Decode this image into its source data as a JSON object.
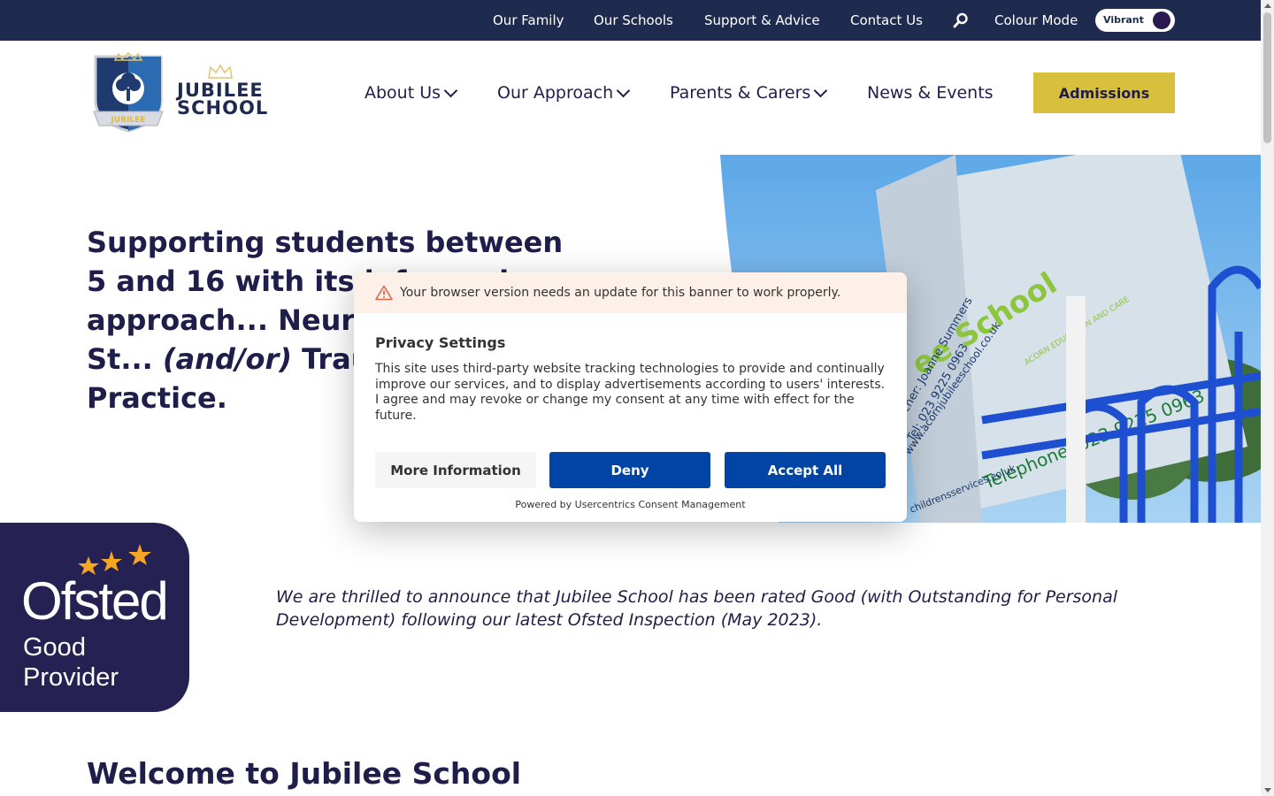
{
  "topbar": {
    "links": [
      "Our Family",
      "Our Schools",
      "Support & Advice",
      "Contact Us"
    ],
    "colour_mode_label": "Colour Mode",
    "toggle_label": "Vibrant"
  },
  "logo": {
    "line1": "JUBILEE",
    "line2": "SCHOOL",
    "badge_text": "JUBILEE"
  },
  "nav": {
    "items": [
      {
        "label": "About Us"
      },
      {
        "label": "Our Approach"
      },
      {
        "label": "Parents & Carers"
      },
      {
        "label": "News & Events"
      }
    ],
    "admissions_label": "Admissions"
  },
  "hero": {
    "title_part1": "Supporting students between 5 and 16 with its ",
    "title_part2": "informed approach... Neurodiversity St... ",
    "title_italic": "(and/or)",
    "title_part3": " Trauma ... Practice.",
    "photo_sign_school": "ee School",
    "photo_sign_head": "teacher: Joanne Summers",
    "photo_sign_tel_small": "Tel: 023 9225 0963",
    "photo_sign_web": "www.acornjubileeschool.co.uk",
    "photo_sign_telephone": "Telephone: 023 9225 0963",
    "photo_sign_acorn": "ACORN EDUCATION AND CARE",
    "photo_sign_email": "childrensservices.co.uk"
  },
  "ofsted": {
    "name": "Ofsted",
    "grade_line1": "Good",
    "grade_line2": "Provider"
  },
  "announcement": "We are thrilled to announce that Jubilee School has been rated Good (with Outstanding for Personal Development) following our latest Ofsted Inspection (May 2023).",
  "welcome_heading": "Welcome to Jubilee School",
  "consent": {
    "warning": "Your browser version needs an update for this banner to work properly.",
    "title": "Privacy Settings",
    "body": "This site uses third-party website tracking technologies to provide and continually improve our services, and to display advertisements according to users' interests. I agree and may revoke or change my consent at any time with effect for the future.",
    "more_info_label": "More Information",
    "deny_label": "Deny",
    "accept_label": "Accept All",
    "powered_by": "Powered by Usercentrics Consent Management"
  },
  "colors": {
    "topbar": "#1e2b4f",
    "navy_text": "#1f1d4a",
    "admissions_yellow": "#d8bf3c",
    "ofsted_purple": "#252253",
    "ofsted_star": "#f6a623",
    "consent_blue": "#0045a5",
    "warning_bg": "#fdf0e8"
  },
  "icons": {
    "search": "search-icon",
    "chevron": "chevron-down-icon",
    "warning": "warning-icon"
  }
}
